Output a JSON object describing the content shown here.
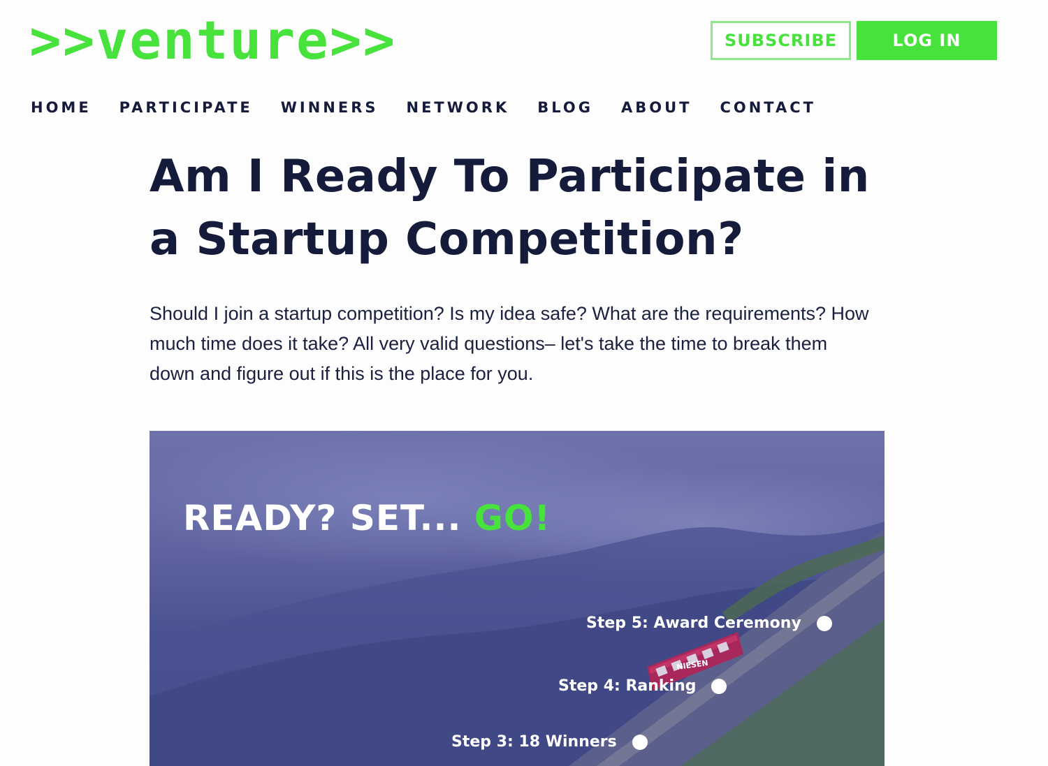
{
  "header": {
    "logo": ">>venture>>",
    "subscribe_label": "SUBSCRIBE",
    "login_label": "LOG IN"
  },
  "nav": {
    "items": [
      "HOME",
      "PARTICIPATE",
      "WINNERS",
      "NETWORK",
      "BLOG",
      "ABOUT",
      "CONTACT"
    ]
  },
  "article": {
    "title": "Am I Ready To Participate in a Startup Competition?",
    "intro": "Should I join a startup competition? Is my idea safe? What are the requirements? How much time does it take? All very valid questions– let's take the time to break them down and figure out if this is the place for you."
  },
  "hero": {
    "heading_main": "READY? SET... ",
    "heading_accent": "GO!",
    "train_sign": "NIESEN",
    "steps": [
      {
        "label": "Step 5: Award Ceremony"
      },
      {
        "label": "Step 4: Ranking"
      },
      {
        "label": "Step 3: 18 Winners"
      }
    ]
  },
  "colors": {
    "brand_green": "#47e23c",
    "navy_text": "#151b3a",
    "hero_overlay": "#5f64a0"
  }
}
